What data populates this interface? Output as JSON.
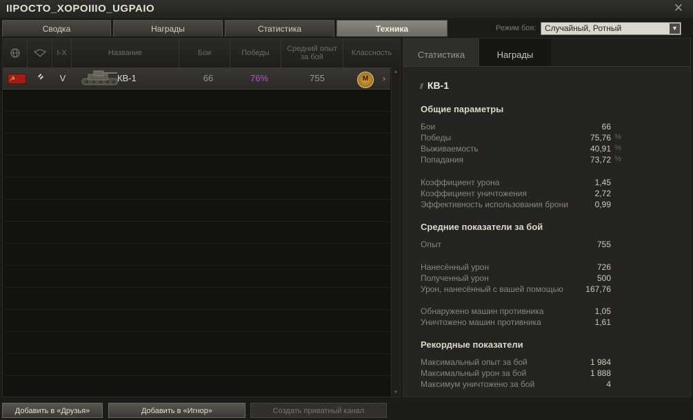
{
  "window": {
    "title": "IIPOCTO_XOPOIIIO_UGPAIO"
  },
  "tabs": [
    {
      "label": "Сводка"
    },
    {
      "label": "Награды"
    },
    {
      "label": "Статистика"
    },
    {
      "label": "Техника"
    }
  ],
  "battle_mode": {
    "label": "Режим боя:",
    "value": "Случайный, Ротный"
  },
  "table": {
    "headers": {
      "nation": "globe-icon",
      "type": "tank-type-icon",
      "tier": "I-X",
      "name": "Название",
      "battles": "Бои",
      "wins": "Победы",
      "avg_xp": "Средний опыт за бой",
      "mastery": "Классность"
    },
    "rows": [
      {
        "nation": "USSR",
        "flag_glyph": "☭",
        "type_icon": "heavy-tank-icon",
        "tier": "V",
        "name": "КВ-1",
        "battles": "66",
        "wins": "76%",
        "avg_xp": "755",
        "mastery": "М"
      }
    ]
  },
  "details": {
    "tabs": [
      {
        "label": "Статистика"
      },
      {
        "label": "Награды"
      }
    ],
    "vehicle": "КВ-1",
    "general_title": "Общие параметры",
    "general": [
      {
        "label": "Бои",
        "value": "66",
        "unit": ""
      },
      {
        "label": "Победы",
        "value": "75,76",
        "unit": "%"
      },
      {
        "label": "Выживаемость",
        "value": "40,91",
        "unit": "%"
      },
      {
        "label": "Попадания",
        "value": "73,72",
        "unit": "%"
      }
    ],
    "ratios": [
      {
        "label": "Коэффициент урона",
        "value": "1,45"
      },
      {
        "label": "Коэффициент уничтожения",
        "value": "2,72"
      },
      {
        "label": "Эффективность использования брони",
        "value": "0,99"
      }
    ],
    "avg_title": "Средние показатели за бой",
    "avg_xp": {
      "label": "Опыт",
      "value": "755"
    },
    "damage": [
      {
        "label": "Нанесённый урон",
        "value": "726"
      },
      {
        "label": "Полученный урон",
        "value": "500"
      },
      {
        "label": "Урон, нанесённый с вашей помощью",
        "value": "167,76"
      }
    ],
    "enemies": [
      {
        "label": "Обнаружено машин противника",
        "value": "1,05"
      },
      {
        "label": "Уничтожено машин противника",
        "value": "1,61"
      }
    ],
    "records_title": "Рекордные показатели",
    "records": [
      {
        "label": "Максимальный опыт за бой",
        "value": "1 984"
      },
      {
        "label": "Максимальный урон за бой",
        "value": "1 888"
      },
      {
        "label": "Максимум уничтожено за бой",
        "value": "4"
      }
    ]
  },
  "buttons": {
    "add_friend": "Добавить в «Друзья»",
    "add_ignore": "Добавить в «Игнор»",
    "private_channel": "Создать приватный канал"
  },
  "colors": {
    "wins": "#b84fd6",
    "mastery_gold": "#d8a33c"
  }
}
